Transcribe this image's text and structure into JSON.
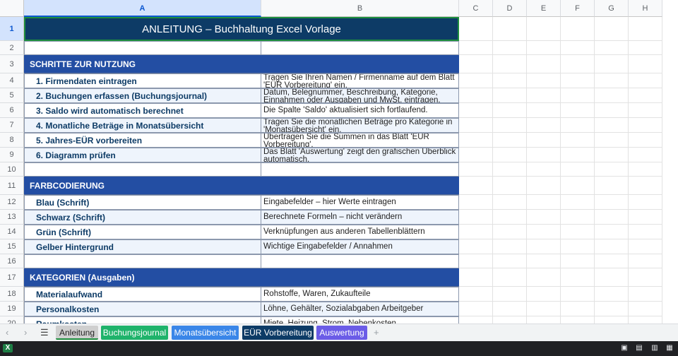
{
  "columns": [
    "A",
    "B",
    "C",
    "D",
    "E",
    "F",
    "G",
    "H"
  ],
  "title": "ANLEITUNG  –  Buchhaltung Excel Vorlage",
  "sections": {
    "steps": "SCHRITTE ZUR NUTZUNG",
    "colors": "FARBCODIERUNG",
    "categories": "KATEGORIEN (Ausgaben)"
  },
  "steps": [
    {
      "label": "1. Firmendaten eintragen",
      "desc": "Tragen Sie Ihren Namen / Firmenname auf dem Blatt 'EÜR Vorbereitung' ein."
    },
    {
      "label": "2. Buchungen erfassen (Buchungsjournal)",
      "desc": "Datum, Belegnummer, Beschreibung, Kategorie, Einnahmen oder Ausgaben und MwSt. eintragen."
    },
    {
      "label": "3. Saldo wird automatisch berechnet",
      "desc": "Die Spalte 'Saldo' aktualisiert sich fortlaufend."
    },
    {
      "label": "4. Monatliche Beträge in Monatsübersicht",
      "desc": "Tragen Sie die monatlichen Beträge pro Kategorie in 'Monatsübersicht' ein."
    },
    {
      "label": "5. Jahres-EÜR vorbereiten",
      "desc": "Übertragen Sie die Summen in das Blatt 'EÜR Vorbereitung'."
    },
    {
      "label": "6. Diagramm prüfen",
      "desc": "Das Blatt 'Auswertung' zeigt den grafischen Überblick automatisch."
    }
  ],
  "colors": [
    {
      "label": "Blau (Schrift)",
      "desc": "Eingabefelder – hier Werte eintragen"
    },
    {
      "label": "Schwarz (Schrift)",
      "desc": "Berechnete Formeln – nicht verändern"
    },
    {
      "label": "Grün (Schrift)",
      "desc": "Verknüpfungen aus anderen Tabellenblättern"
    },
    {
      "label": "Gelber Hintergrund",
      "desc": "Wichtige Eingabefelder / Annahmen"
    }
  ],
  "categories": [
    {
      "label": "Materialaufwand",
      "desc": "Rohstoffe, Waren, Zukaufteile"
    },
    {
      "label": "Personalkosten",
      "desc": "Löhne, Gehälter, Sozialabgaben Arbeitgeber"
    },
    {
      "label": "Raumkosten",
      "desc": "Miete, Heizung, Strom, Nebenkosten"
    }
  ],
  "tabs": [
    {
      "label": "Anleitung",
      "bg": "#cfcfcf",
      "fg": "#1f1f1f"
    },
    {
      "label": "Buchungsjournal",
      "bg": "#1fb36b",
      "fg": "#ffffff"
    },
    {
      "label": "Monatsübersicht",
      "bg": "#3a86e8",
      "fg": "#ffffff"
    },
    {
      "label": "EÜR Vorbereitung",
      "bg": "#0d3b66",
      "fg": "#ffffff"
    },
    {
      "label": "Auswertung",
      "bg": "#6b5ce7",
      "fg": "#ffffff"
    }
  ],
  "nav_icons": [
    "chevron-left-icon",
    "chevron-right-icon",
    "menu-icon",
    "add-sheet-icon"
  ],
  "accent": "#0b57d0"
}
